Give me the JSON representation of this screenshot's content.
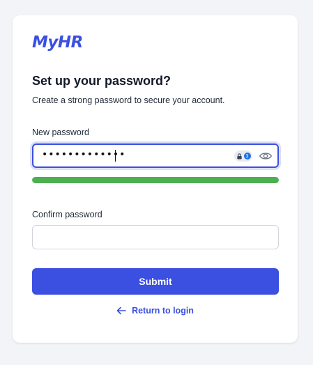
{
  "brand": {
    "logo_text": "MyHR",
    "color": "#3b4fe0"
  },
  "form": {
    "title": "Set up your password?",
    "subtitle": "Create a strong password to secure your account.",
    "new_password": {
      "label": "New password",
      "masked_value": "•••••••••••••",
      "password_manager_icon": "password-manager-icon",
      "toggle_icon": "eye-icon"
    },
    "strength": {
      "level": 1.0,
      "color": "#4caf50"
    },
    "confirm_password": {
      "label": "Confirm password",
      "value": ""
    },
    "submit_label": "Submit",
    "return_link": {
      "label": "Return to login",
      "icon": "arrow-left-icon"
    }
  }
}
